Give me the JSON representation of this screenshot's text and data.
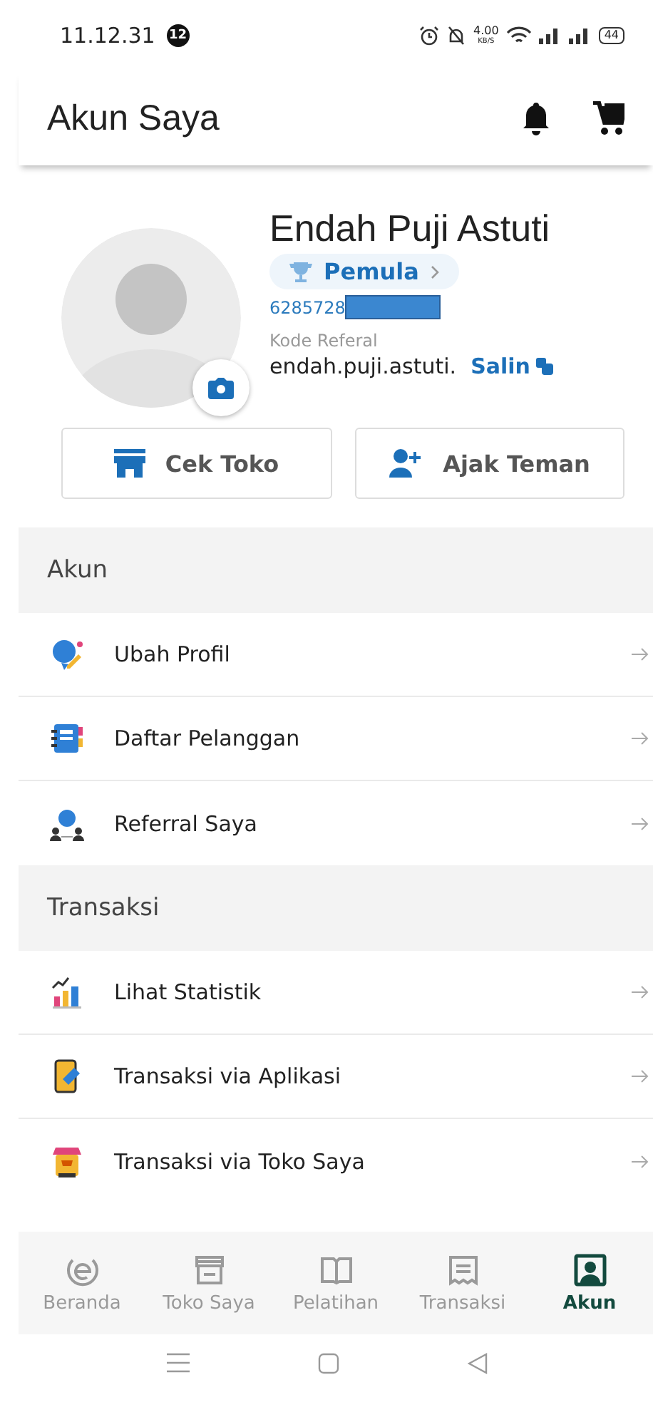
{
  "status_bar": {
    "time": "11.12.31",
    "notification_count": "12",
    "speed": "4.00",
    "speed_unit": "KB/S",
    "battery": "44"
  },
  "header": {
    "title": "Akun Saya"
  },
  "profile": {
    "name": "Endah Puji Astuti",
    "level_badge": "Pemula",
    "phone": "6285728",
    "phone_redacted": true,
    "referral_label": "Kode Referal",
    "referral_code": "endah.puji.astuti.",
    "copy_label": "Salin"
  },
  "actions": [
    {
      "label": "Cek Toko"
    },
    {
      "label": "Ajak Teman"
    }
  ],
  "sections": [
    {
      "title": "Akun",
      "items": [
        {
          "label": "Ubah Profil"
        },
        {
          "label": "Daftar Pelanggan"
        },
        {
          "label": "Referral Saya"
        }
      ]
    },
    {
      "title": "Transaksi",
      "items": [
        {
          "label": "Lihat Statistik"
        },
        {
          "label": "Transaksi via Aplikasi"
        },
        {
          "label": "Transaksi via Toko Saya"
        }
      ]
    }
  ],
  "bottom_nav": [
    {
      "label": "Beranda",
      "selected": false
    },
    {
      "label": "Toko Saya",
      "selected": false
    },
    {
      "label": "Pelatihan",
      "selected": false
    },
    {
      "label": "Transaksi",
      "selected": false
    },
    {
      "label": "Akun",
      "selected": true
    }
  ]
}
